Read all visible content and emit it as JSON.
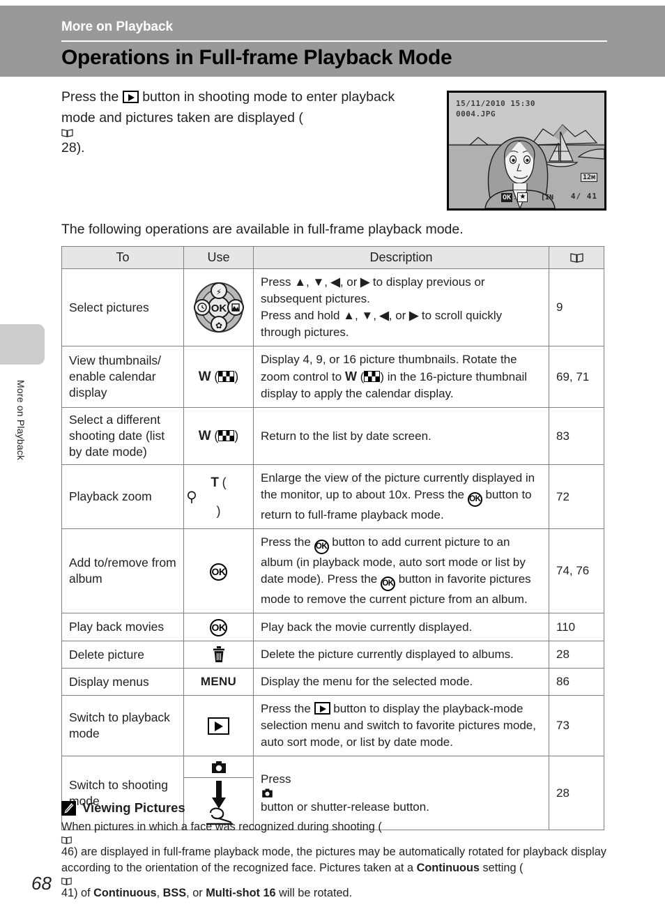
{
  "header": {
    "kicker": "More on Playback",
    "title": "Operations in Full-frame Playback Mode"
  },
  "sidebar": {
    "tab_label": "More on Playback"
  },
  "intro": {
    "part1": "Press the ",
    "part2": " button in shooting mode to enter playback mode and pictures taken are displayed (",
    "ref": " 28).",
    "play_icon": "playback-icon",
    "book_icon": "book-icon"
  },
  "monitor": {
    "datetime": "15/11/2010 15:30",
    "filename": "0004.JPG",
    "image_size": "12м",
    "frame_counter": "4/ 41",
    "ok_label": "OK",
    "ok_sep": ":",
    "star": "★",
    "battery": "[IN"
  },
  "leadin": "The following operations are available in full-frame playback mode.",
  "table": {
    "headers": {
      "to": "To",
      "use": "Use",
      "description": "Description",
      "reference": "book-icon"
    },
    "rows": [
      {
        "to": "Select pictures",
        "use_icon": "multi-selector-icon",
        "use_label": "",
        "description": "Press ▲, ▼, ◀, or ▶ to display previous or subsequent pictures.\nPress and hold ▲, ▼, ◀, or ▶ to scroll quickly through pictures.",
        "reference": "9"
      },
      {
        "to": "View thumbnails/ enable calendar display",
        "use_icon": "wide-zoom-thumbnail-icon",
        "use_label": "W",
        "description": "Display 4, 9, or 16 picture thumbnails. Rotate the zoom control to W (thumbnail) in the 16-picture thumbnail display to apply the calendar display.",
        "reference": "69, 71"
      },
      {
        "to": "Select a different shooting date (list by date mode)",
        "use_icon": "wide-zoom-thumbnail-icon",
        "use_label": "W",
        "description": "Return to the list by date screen.",
        "reference": "83"
      },
      {
        "to": "Playback zoom",
        "use_icon": "tele-zoom-magnifier-icon",
        "use_label": "T",
        "description": "Enlarge the view of the picture currently displayed in the monitor, up to about 10x. Press the OK button to return to full-frame playback mode.",
        "reference": "72"
      },
      {
        "to": "Add to/remove from album",
        "use_icon": "ok-button-icon",
        "use_label": "",
        "description": "Press the OK button to add current picture to an album (in playback mode, auto sort mode or list by date mode). Press the OK button in favorite pictures mode to remove the current picture from an album.",
        "reference": "74, 76"
      },
      {
        "to": "Play back movies",
        "use_icon": "ok-button-icon",
        "use_label": "",
        "description": "Play back the movie currently displayed.",
        "reference": "110"
      },
      {
        "to": "Delete picture",
        "use_icon": "trash-icon",
        "use_label": "",
        "description": "Delete the picture currently displayed to albums.",
        "reference": "28"
      },
      {
        "to": "Display menus",
        "use_icon": "menu-button-icon",
        "use_label": "MENU",
        "description": "Display the menu for the selected mode.",
        "reference": "86"
      },
      {
        "to": "Switch to playback mode",
        "use_icon": "playback-button-icon",
        "use_label": "",
        "description": "Press the playback button to display the playback-mode selection menu and switch to favorite pictures mode, auto sort mode, or list by date mode.",
        "reference": "73"
      },
      {
        "to": "Switch to shooting mode",
        "use_icon": "camera-button-and-shutter-icon",
        "use_label": "",
        "description": "Press camera button or shutter-release button.",
        "reference": "28"
      }
    ]
  },
  "row_text": {
    "r1_desc_a": "Press ",
    "r1_desc_b": ", ",
    "r1_desc_c": ", or ",
    "r1_desc_d": " to display previous or subsequent pictures.",
    "r1_desc_e": "Press and hold ",
    "r1_desc_f": " to scroll quickly through pictures.",
    "r2_desc_a": "Display 4, 9, or 16 picture thumbnails. Rotate the zoom control to ",
    "r2_desc_b": " in the 16-picture thumbnail display to apply the calendar display.",
    "r3_desc": "Return to the list by date screen.",
    "r4_desc_a": "Enlarge the view of the picture currently displayed in the monitor, up to about 10x. Press the ",
    "r4_desc_b": " button to return to full-frame playback mode.",
    "r5_desc_a": "Press the ",
    "r5_desc_b": " button to add current picture to an album (in playback mode, auto sort mode or list by date mode). Press the ",
    "r5_desc_c": " button in favorite pictures mode to remove the current picture from an album.",
    "r6_desc": "Play back the movie currently displayed.",
    "r7_desc": "Delete the picture currently displayed to albums.",
    "r8_desc": "Display the menu for the selected mode.",
    "r9_desc_a": "Press the ",
    "r9_desc_b": " button to display the playback-mode selection menu and switch to favorite pictures mode, auto sort mode, or list by date mode.",
    "r10_desc_a": "Press ",
    "r10_desc_b": " button or shutter-release button."
  },
  "note": {
    "icon": "pencil-icon",
    "title": "Viewing Pictures",
    "body_a": "When pictures in which a face was recognized during shooting (",
    "body_b": " 46) are displayed in full-frame playback mode, the pictures may be automatically rotated for playback display according to the orientation of the recognized face. Pictures taken at a ",
    "bold1": "Continuous",
    "body_c": " setting (",
    "body_d": " 41) of ",
    "bold2": "Continuous",
    "body_e": ", ",
    "bold3": "BSS",
    "body_f": ", or ",
    "bold4": "Multi-shot 16",
    "body_g": " will be rotated."
  },
  "page_number": "68",
  "colors": {
    "header_band": "#999999",
    "table_header_bg": "#e6e6e6",
    "to_column_bg": "#e6e6e6",
    "border": "#808080",
    "side_tab": "#cccccc"
  }
}
